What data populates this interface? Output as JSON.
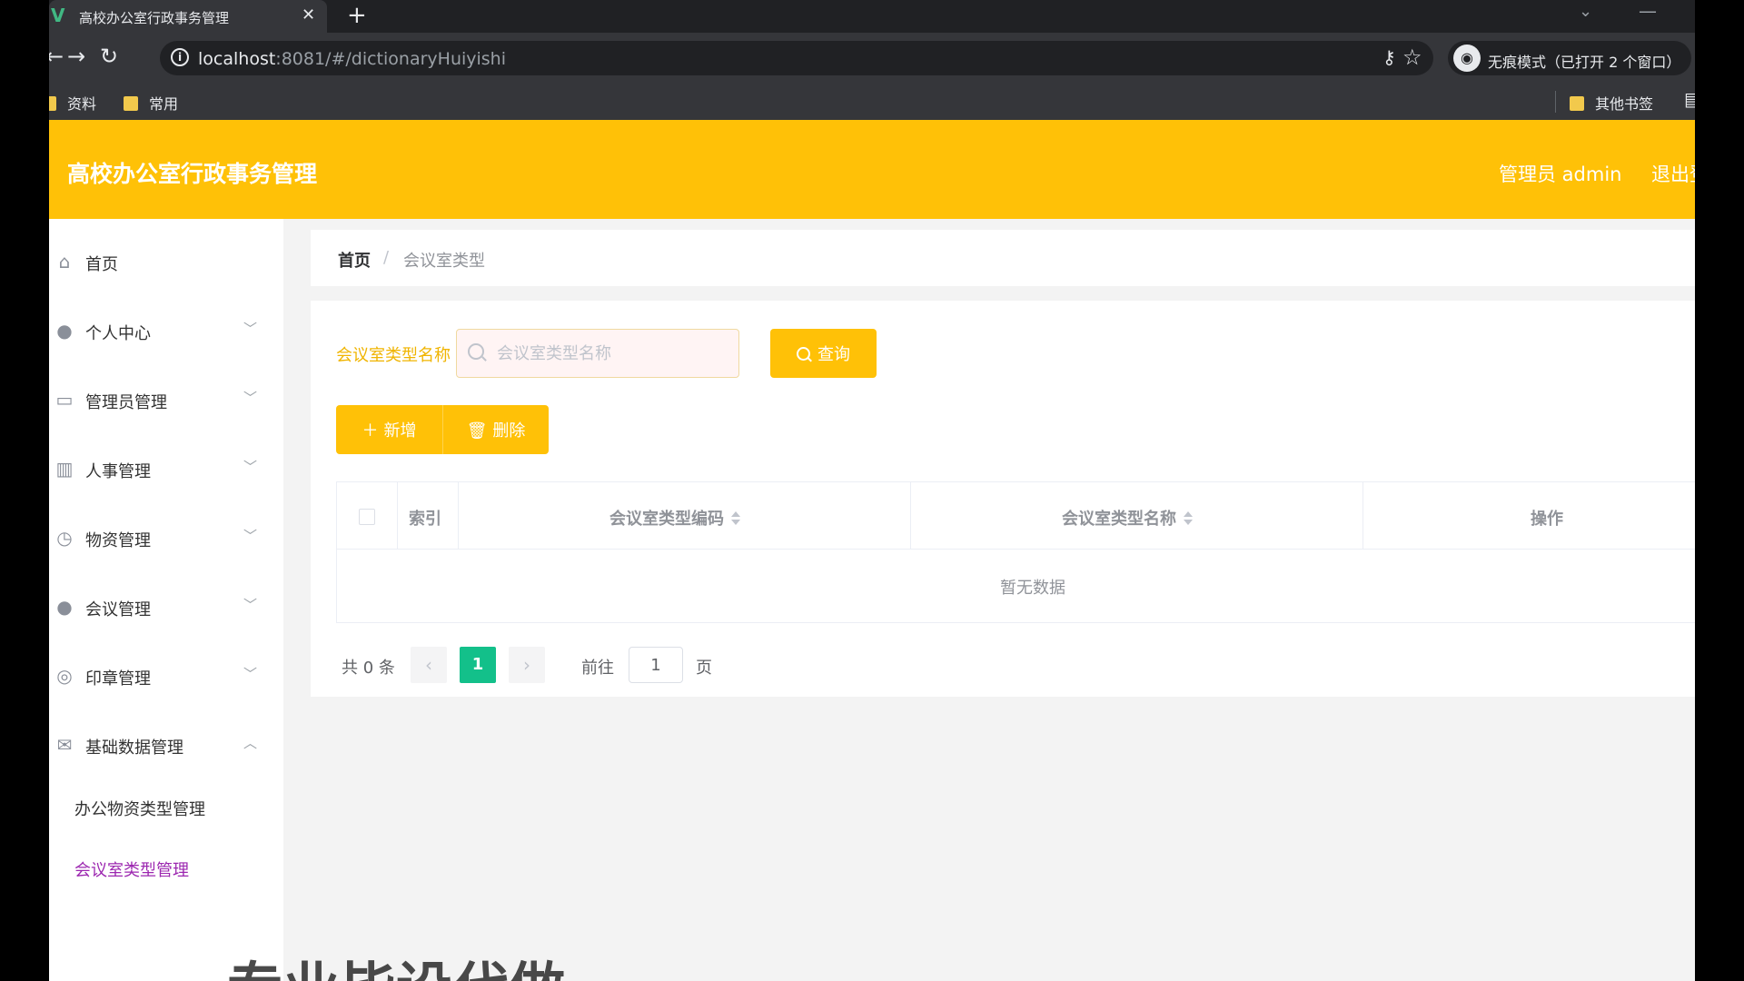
{
  "browser": {
    "tab_title": "高校办公室行政事务管理",
    "tab_close": "✕",
    "new_tab": "+",
    "url_host": "localhost",
    "url_path": ":8081/#/dictionaryHuiyishi",
    "incognito_label": "无痕模式（已打开 2 个窗口）",
    "bookmarks": [
      "资料",
      "常用"
    ],
    "other_bookmarks": "其他书签"
  },
  "header": {
    "title": "高校办公室行政事务管理",
    "admin_label": "管理员 admin",
    "logout_label": "退出登录"
  },
  "sidebar": {
    "items": [
      {
        "label": "首页",
        "icon": "home-icon"
      },
      {
        "label": "个人中心",
        "icon": "user-icon"
      },
      {
        "label": "管理员管理",
        "icon": "id-card-icon"
      },
      {
        "label": "人事管理",
        "icon": "books-icon"
      },
      {
        "label": "物资管理",
        "icon": "compass-icon"
      },
      {
        "label": "会议管理",
        "icon": "map-pin-icon"
      },
      {
        "label": "印章管理",
        "icon": "stamp-icon"
      },
      {
        "label": "基础数据管理",
        "icon": "mail-icon"
      }
    ],
    "subitems": [
      {
        "label": "办公物资类型管理"
      },
      {
        "label": "会议室类型管理",
        "active": true
      }
    ]
  },
  "breadcrumb": {
    "home": "首页",
    "separator": "/",
    "current": "会议室类型"
  },
  "search": {
    "label": "会议室类型名称",
    "placeholder": "会议室类型名称",
    "value": "",
    "query_label": "查询"
  },
  "toolbar": {
    "add_label": "新增",
    "delete_label": "删除"
  },
  "table": {
    "columns": [
      "索引",
      "会议室类型编码",
      "会议室类型名称",
      "操作"
    ],
    "empty_text": "暂无数据"
  },
  "pagination": {
    "total": "共 0 条",
    "current_page": "1",
    "goto_label": "前往",
    "goto_value": "1",
    "suffix": "页"
  },
  "watermark": "专业毕设代做",
  "colors": {
    "accent": "#ffc107",
    "active_submenu": "#9c27b0",
    "page_active": "#13c08a"
  }
}
